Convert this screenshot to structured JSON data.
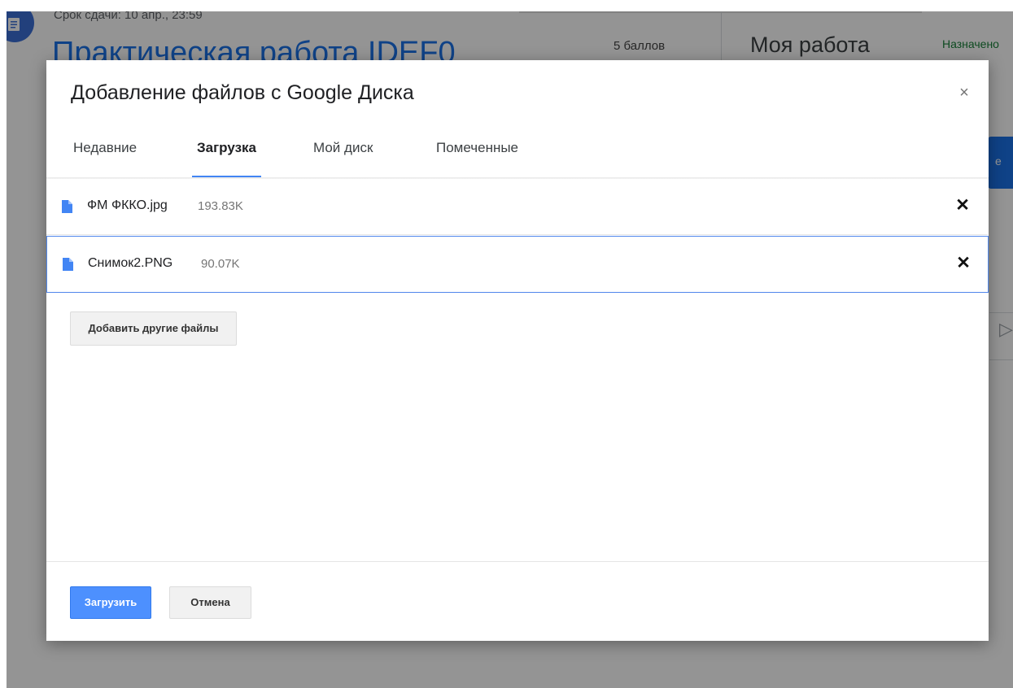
{
  "background": {
    "due_text": "Срок сдачи: 10 апр., 23:59",
    "assignment_title": "Практическая работа IDEF0",
    "points": "5 баллов",
    "my_work": "Моя работа",
    "assigned": "Назначено",
    "side_button_char": "e"
  },
  "dialog": {
    "title": "Добавление файлов с Google Диска",
    "close_glyph": "×",
    "tabs": [
      {
        "label": "Недавние",
        "active": false
      },
      {
        "label": "Загрузка",
        "active": true
      },
      {
        "label": "Мой диск",
        "active": false
      },
      {
        "label": "Помеченные",
        "active": false
      }
    ],
    "files": [
      {
        "name": "ФМ ФККО.jpg",
        "size": "193.83K",
        "remove_glyph": "✕"
      },
      {
        "name": "Снимок2.PNG",
        "size": "90.07K",
        "remove_glyph": "✕"
      }
    ],
    "add_more_label": "Добавить другие файлы",
    "upload_label": "Загрузить",
    "cancel_label": "Отмена"
  },
  "colors": {
    "accent": "#4285f4",
    "upload_button": "#4d90fe",
    "file_icon": "#4285f4"
  },
  "icons": [
    "document-icon",
    "file-icon",
    "close-icon",
    "remove-icon",
    "send-icon"
  ]
}
